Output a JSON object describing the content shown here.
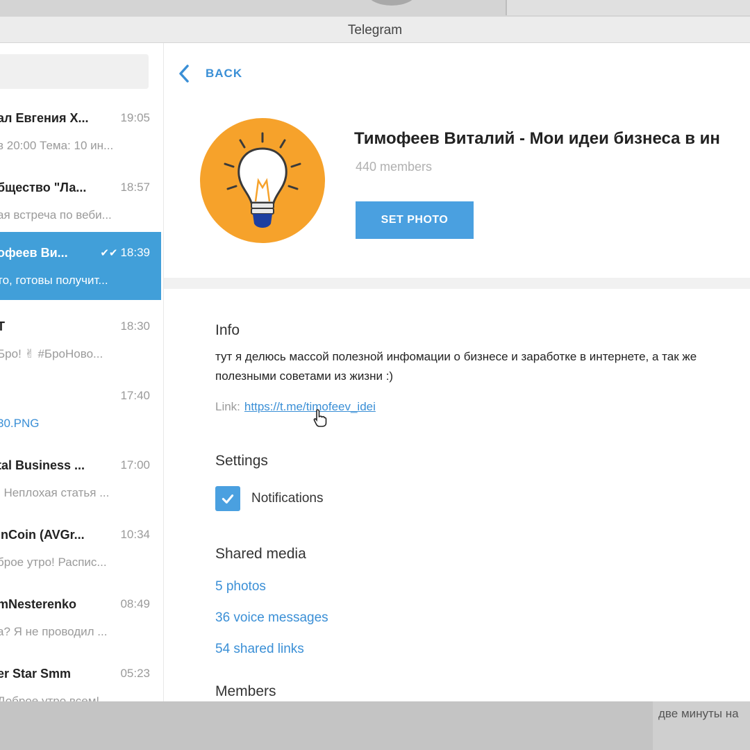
{
  "window": {
    "title": "Telegram"
  },
  "sidebar": {
    "chats": [
      {
        "name": "ал Евгения Х...",
        "time": "19:05",
        "preview": "в 20:00 Тема: 10 ин...",
        "active": false
      },
      {
        "name": "бщество \"Ла...",
        "time": "18:57",
        "preview": "ая встреча по веби...",
        "active": false
      },
      {
        "name": "офеев Ви...",
        "time": "18:39",
        "check": "✔✔",
        "preview": "то, готовы получит...",
        "active": true
      },
      {
        "name": "T",
        "time": "18:30",
        "preview": "Бро! ✌ #БроНово...",
        "active": false
      },
      {
        "name": "",
        "time": "17:40",
        "preview_accent": "30.PNG",
        "active": false
      },
      {
        "name": "tal Business ...",
        "time": "17:00",
        "preview_accent": ": ",
        "preview": "Неплохая статья ...",
        "active": false
      },
      {
        "name": "inCoin (AVGr...",
        "time": "10:34",
        "preview": "брое утро! Распис...",
        "active": false
      },
      {
        "name": "mNesterenko",
        "time": "08:49",
        "preview": "а? Я не проводил ...",
        "active": false
      },
      {
        "name": "er Star Smm",
        "time": "05:23",
        "preview": "Доброе утро всем!",
        "active": false
      }
    ]
  },
  "header": {
    "back_label": "BACK"
  },
  "profile": {
    "title": "Тимофеев Виталий - Мои идеи бизнеса в ин",
    "members": "440 members",
    "set_photo_label": "SET PHOTO",
    "avatar_color": "#f6a22b"
  },
  "info": {
    "heading": "Info",
    "description": "тут я делюсь массой полезной инфомации о бизнесе и заработке в интернете, а так же полезными советами из жизни :)",
    "link_label": "Link:",
    "link_url": "https://t.me/timofeev_idei"
  },
  "settings": {
    "heading": "Settings",
    "notifications_label": "Notifications",
    "notifications_checked": true
  },
  "shared_media": {
    "heading": "Shared media",
    "photos": "5 photos",
    "voice": "36 voice messages",
    "links": "54 shared links"
  },
  "members_section": {
    "heading": "Members"
  },
  "bottom": {
    "caption": "две минуты на"
  },
  "colors": {
    "accent": "#419fd9",
    "button": "#4aa0e0",
    "link": "#3a8fd6"
  }
}
